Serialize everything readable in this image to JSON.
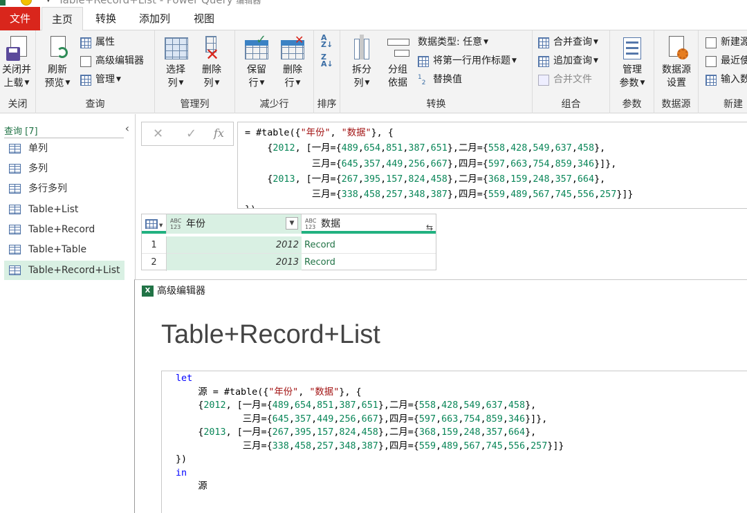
{
  "titlebar": {
    "title": "Table+Record+List - Power Query",
    "suffix": "编辑器"
  },
  "tabs": {
    "file": "文件",
    "home": "主页",
    "transform": "转换",
    "add_column": "添加列",
    "view": "视图"
  },
  "ribbon": {
    "close": {
      "close_load_1": "关闭并",
      "close_load_2": "上载",
      "label": "关闭"
    },
    "query": {
      "refresh_1": "刷新",
      "refresh_2": "预览",
      "properties": "属性",
      "advanced_editor": "高级编辑器",
      "manage": "管理",
      "label": "查询"
    },
    "manage_cols": {
      "choose_1": "选择",
      "choose_2": "列",
      "remove_1": "删除",
      "remove_2": "列",
      "label": "管理列"
    },
    "reduce_rows": {
      "keep_1": "保留",
      "keep_2": "行",
      "remove_1": "删除",
      "remove_2": "行",
      "label": "减少行"
    },
    "sort": {
      "label": "排序"
    },
    "transform": {
      "split_1": "拆分",
      "split_2": "列",
      "group_1": "分组",
      "group_2": "依据",
      "data_type": "数据类型: 任意",
      "first_row_header": "将第一行用作标题",
      "replace_values": "替换值",
      "label": "转换"
    },
    "combine": {
      "merge": "合并查询",
      "append": "追加查询",
      "combine_files": "合并文件",
      "label": "组合"
    },
    "params": {
      "manage_1": "管理",
      "manage_2": "参数",
      "label": "参数"
    },
    "datasource": {
      "settings_1": "数据源",
      "settings_2": "设置",
      "label": "数据源"
    },
    "newquery": {
      "new_source": "新建源",
      "recent": "最近使",
      "enter_data": "输入数",
      "label": "新建"
    }
  },
  "queries": {
    "header": "查询 [7]",
    "items": [
      "单列",
      "多列",
      "多行多列",
      "Table+List",
      "Table+Record",
      "Table+Table",
      "Table+Record+List"
    ],
    "selected": 6
  },
  "formula_bar": {
    "cancel": "✕",
    "commit": "✓",
    "fx": "fx",
    "lines": [
      "= #table({\"年份\", \"数据\"}, {",
      "    {2012, [一月={489,654,851,387,651},二月={558,428,549,637,458},",
      "            三月={645,357,449,256,667},四月={597,663,754,859,346}]},",
      "    {2013, [一月={267,395,157,824,458},二月={368,159,248,357,664},",
      "            三月={338,458,257,348,387},四月={559,489,567,745,556,257}]}",
      "})"
    ]
  },
  "grid": {
    "type_icon": "ABC\n123",
    "columns": [
      "年份",
      "数据"
    ],
    "rows": [
      {
        "n": "1",
        "year": "2012",
        "data": "Record"
      },
      {
        "n": "2",
        "year": "2013",
        "data": "Record"
      }
    ]
  },
  "advanced_editor": {
    "window_title": "高级编辑器",
    "heading": "Table+Record+List",
    "code": [
      "let",
      "    源 = #table({\"年份\", \"数据\"}, {",
      "    {2012, [一月={489,654,851,387,651},二月={558,428,549,637,458},",
      "            三月={645,357,449,256,667},四月={597,663,754,859,346}]},",
      "    {2013, [一月={267,395,157,824,458},二月={368,159,248,357,664},",
      "            三月={338,458,257,348,387},四月={559,489,567,745,556,257}]}",
      "})",
      "in",
      "    源"
    ]
  }
}
